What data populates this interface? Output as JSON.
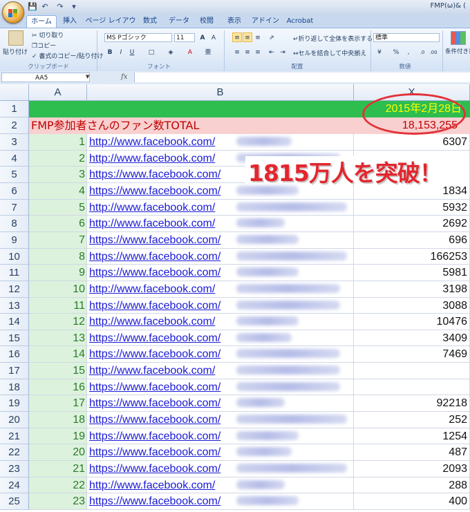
{
  "titlebar": {
    "title": "FMP(ω)& ("
  },
  "tabs": [
    "ホーム",
    "挿入",
    "ページ レイアウト",
    "数式",
    "データ",
    "校閲",
    "表示",
    "アドイン",
    "Acrobat"
  ],
  "ribbon": {
    "clipboard": {
      "paste": "貼り付け",
      "cut": "切り取り",
      "copy": "コピー",
      "format_painter": "書式のコピー/貼り付け",
      "label": "クリップボード"
    },
    "font": {
      "name": "MS Pゴシック",
      "size": "11",
      "label": "フォント"
    },
    "alignment": {
      "wrap_text": "折り返して全体を表示する",
      "merge_center": "セルを結合して中央揃え",
      "label": "配置"
    },
    "number": {
      "format": "標準",
      "label": "数値"
    },
    "styles": {
      "conditional": "条件付き書式"
    }
  },
  "formula_bar": {
    "name_box": "AA5",
    "fx": "fx",
    "value": ""
  },
  "columns": [
    "A",
    "B",
    "X"
  ],
  "header_row": {
    "row": "1",
    "date": "2015年2月28日"
  },
  "total_row": {
    "row": "2",
    "label": "FMP参加者さんのファン数TOTAL",
    "value": "18,153,255"
  },
  "callout": "1815万人を突破！",
  "rows": [
    {
      "row": "3",
      "num": "1",
      "url": "http://www.facebook.com/",
      "fans": "6307"
    },
    {
      "row": "4",
      "num": "2",
      "url": "http://www.facebook.com/",
      "fans": ""
    },
    {
      "row": "5",
      "num": "3",
      "url": "https://www.facebook.com/",
      "fans": ""
    },
    {
      "row": "6",
      "num": "4",
      "url": "https://www.facebook.com/",
      "fans": "1834"
    },
    {
      "row": "7",
      "num": "5",
      "url": "http://www.facebook.com/",
      "fans": "5932"
    },
    {
      "row": "8",
      "num": "6",
      "url": "http://www.facebook.com/",
      "fans": "2692"
    },
    {
      "row": "9",
      "num": "7",
      "url": "https://www.facebook.com/",
      "fans": "696"
    },
    {
      "row": "10",
      "num": "8",
      "url": "https://www.facebook.com/",
      "fans": "166253"
    },
    {
      "row": "11",
      "num": "9",
      "url": "https://www.facebook.com/",
      "fans": "5981"
    },
    {
      "row": "12",
      "num": "10",
      "url": "http://www.facebook.com/",
      "fans": "3198"
    },
    {
      "row": "13",
      "num": "11",
      "url": "https://www.facebook.com/",
      "fans": "3088"
    },
    {
      "row": "14",
      "num": "12",
      "url": "http://www.facebook.com/",
      "fans": "10476"
    },
    {
      "row": "15",
      "num": "13",
      "url": "https://www.facebook.com/",
      "fans": "3409"
    },
    {
      "row": "16",
      "num": "14",
      "url": "https://www.facebook.com/",
      "fans": "7469"
    },
    {
      "row": "17",
      "num": "15",
      "url": "http://www.facebook.com/",
      "fans": ""
    },
    {
      "row": "18",
      "num": "16",
      "url": "https://www.facebook.com/",
      "fans": ""
    },
    {
      "row": "19",
      "num": "17",
      "url": "https://www.facebook.com/",
      "fans": "92218"
    },
    {
      "row": "20",
      "num": "18",
      "url": "https://www.facebook.com/",
      "fans": "252"
    },
    {
      "row": "21",
      "num": "19",
      "url": "https://www.facebook.com/",
      "fans": "1254"
    },
    {
      "row": "22",
      "num": "20",
      "url": "https://www.facebook.com/",
      "fans": "487"
    },
    {
      "row": "23",
      "num": "21",
      "url": "https://www.facebook.com/",
      "fans": "2093"
    },
    {
      "row": "24",
      "num": "22",
      "url": "http://www.facebook.com/",
      "fans": "288"
    },
    {
      "row": "25",
      "num": "23",
      "url": "https://www.facebook.com/",
      "fans": "400"
    }
  ],
  "colors": {
    "header_green": "#2ebd4f",
    "total_pink": "#f8d0d0",
    "date_yellow": "#ffff00",
    "accent_red": "#e3262e",
    "link_blue": "#1a1ad6"
  }
}
